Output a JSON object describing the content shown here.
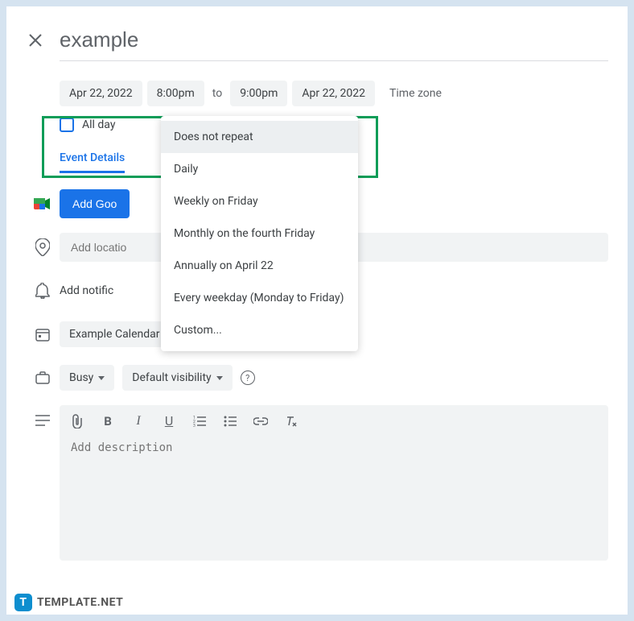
{
  "title": "example",
  "datetime": {
    "start_date": "Apr 22, 2022",
    "start_time": "8:00pm",
    "to_label": "to",
    "end_time": "9:00pm",
    "end_date": "Apr 22, 2022",
    "timezone_label": "Time zone"
  },
  "allday": {
    "label": "All day",
    "checked": false
  },
  "repeat_dropdown": {
    "selected": "Does not repeat",
    "options": [
      "Does not repeat",
      "Daily",
      "Weekly on Friday",
      "Monthly on the fourth Friday",
      "Annually on April 22",
      "Every weekday (Monday to Friday)",
      "Custom..."
    ]
  },
  "tabs": {
    "active": "Event Details",
    "items": [
      "Event Details"
    ]
  },
  "meet_button": "Add Goo",
  "location_placeholder": "Add locatio",
  "notification_label": "Add notific",
  "calendar_selector": "Example Calendar",
  "visibility": {
    "busy": "Busy",
    "default": "Default visibility"
  },
  "description_placeholder": "Add description",
  "watermark": "TEMPLATE.NET"
}
